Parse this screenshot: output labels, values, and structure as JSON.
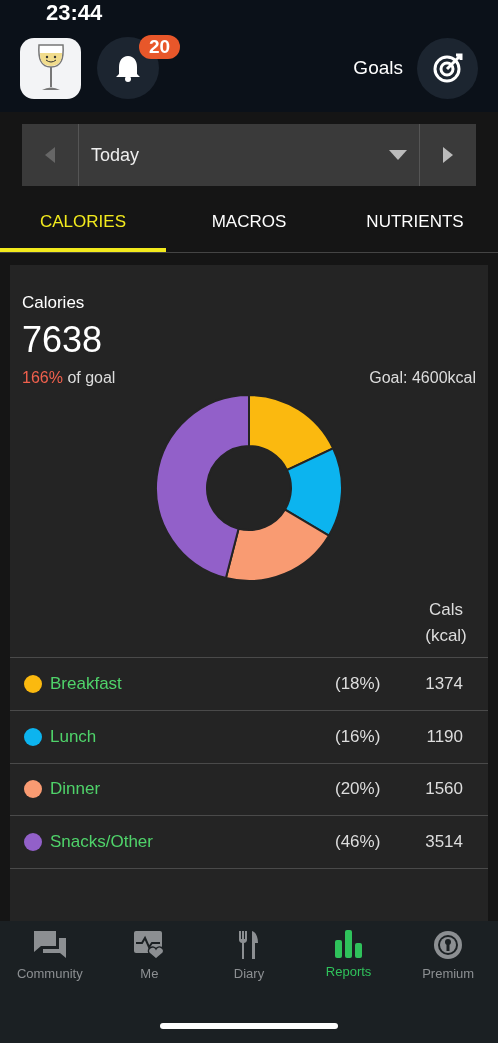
{
  "status_bar": {
    "time": "23:44"
  },
  "header": {
    "notification_count": "20",
    "goals_label": "Goals"
  },
  "date_selector": {
    "value": "Today"
  },
  "tabs": [
    {
      "label": "CALORIES",
      "selected": true
    },
    {
      "label": "MACROS",
      "selected": false
    },
    {
      "label": "NUTRIENTS",
      "selected": false
    }
  ],
  "summary": {
    "title": "Calories",
    "total": "7638",
    "percent_of_goal": "166%",
    "of_goal_text": "of goal",
    "goal": "Goal: 4600kcal"
  },
  "column_header": "Cals (kcal)",
  "meals": [
    {
      "name": "Breakfast",
      "percent": "(18%)",
      "calories": "1374",
      "color": "#fbb90f"
    },
    {
      "name": "Lunch",
      "percent": "(16%)",
      "calories": "1190",
      "color": "#0cb4ef"
    },
    {
      "name": "Dinner",
      "percent": "(20%)",
      "calories": "1560",
      "color": "#f99b72"
    },
    {
      "name": "Snacks/Other",
      "percent": "(46%)",
      "calories": "3514",
      "color": "#9260c9"
    }
  ],
  "bottom_nav": [
    {
      "label": "Community",
      "kind": "chat",
      "selected": false
    },
    {
      "label": "Me",
      "kind": "health",
      "selected": false
    },
    {
      "label": "Diary",
      "kind": "cutlery",
      "selected": false
    },
    {
      "label": "Reports",
      "kind": "chart",
      "selected": true
    },
    {
      "label": "Premium",
      "kind": "badge",
      "selected": false
    }
  ]
}
